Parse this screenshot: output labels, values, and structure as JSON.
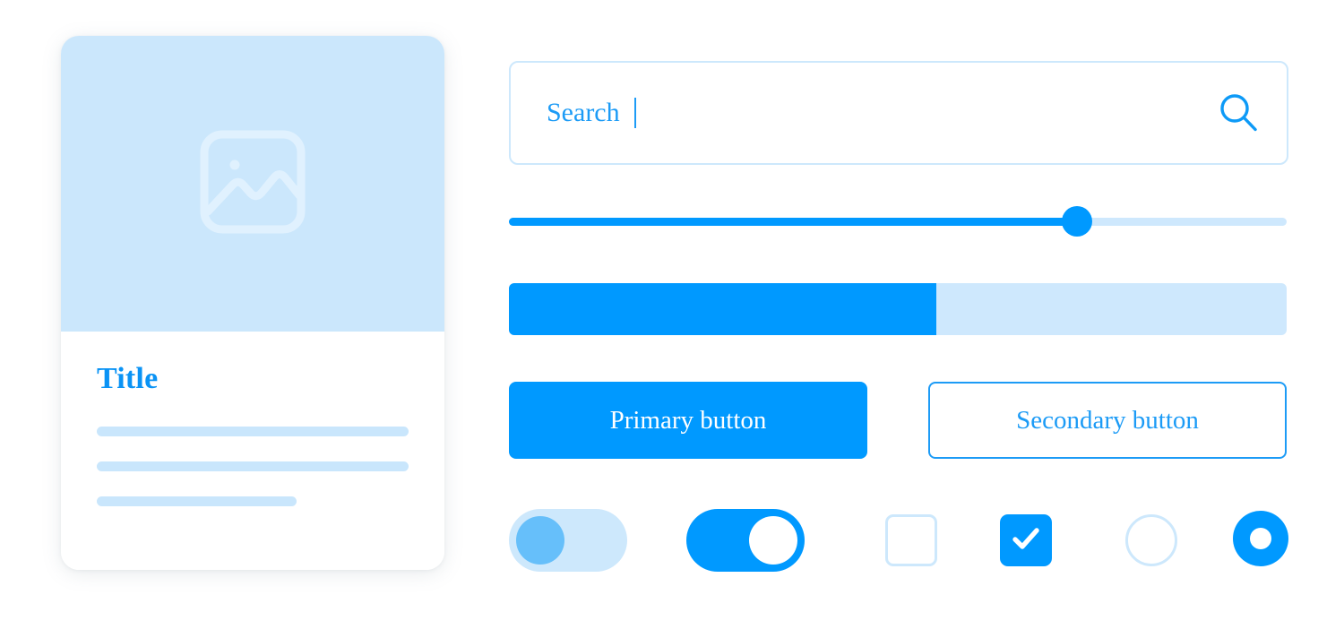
{
  "theme": {
    "primary": "#0099FF",
    "primary_text": "#1C9BF6",
    "tint_light": "#CDE8FC",
    "tint_media": "#CBE7FC",
    "knob_off": "#66BFFA",
    "surface": "#FFFFFF"
  },
  "card": {
    "media_icon": "image-placeholder-icon",
    "title": "Title",
    "skeleton_lines": [
      {
        "width": "full"
      },
      {
        "width": "full"
      },
      {
        "width": "partial"
      }
    ]
  },
  "search": {
    "placeholder": "Search",
    "value": "",
    "caret_visible": true,
    "icon": "search-icon"
  },
  "slider": {
    "value": 73,
    "min": 0,
    "max": 100
  },
  "progress": {
    "value": 55,
    "min": 0,
    "max": 100
  },
  "buttons": {
    "primary_label": "Primary button",
    "secondary_label": "Secondary button"
  },
  "controls": {
    "toggle_off": {
      "name": "toggle-off",
      "state": "off"
    },
    "toggle_on": {
      "name": "toggle-on",
      "state": "on"
    },
    "checkbox_unchecked": {
      "name": "checkbox-unchecked",
      "state": "unchecked"
    },
    "checkbox_checked": {
      "name": "checkbox-checked",
      "state": "checked",
      "icon": "check-icon"
    },
    "radio_unselected": {
      "name": "radio-unselected",
      "state": "unselected"
    },
    "radio_selected": {
      "name": "radio-selected",
      "state": "selected"
    }
  }
}
